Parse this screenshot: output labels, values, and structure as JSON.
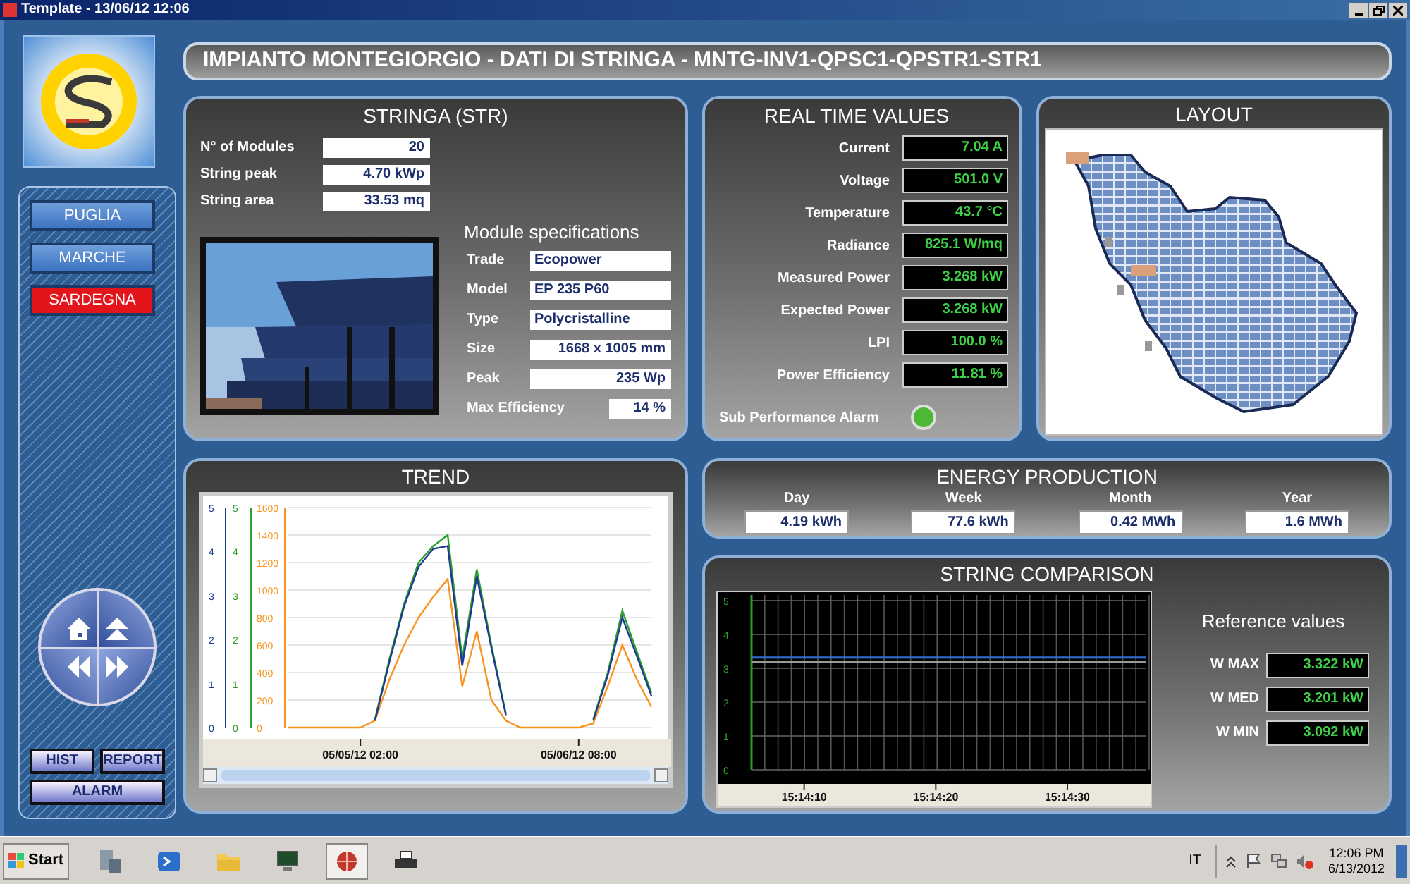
{
  "window": {
    "title": "Template - 13/06/12 12:06"
  },
  "nav": {
    "regions": [
      {
        "label": "PUGLIA",
        "selected": false
      },
      {
        "label": "MARCHE",
        "selected": false
      },
      {
        "label": "SARDEGNA",
        "selected": true
      }
    ],
    "buttons": [
      "HIST",
      "REPORT",
      "ALARM"
    ]
  },
  "header": {
    "title": "IMPIANTO MONTEGIORGIO - DATI DI STRINGA - MNTG-INV1-QPSC1-QPSTR1-STR1"
  },
  "stringa": {
    "title": "STRINGA (STR)",
    "fields": [
      {
        "label": "N° of Modules",
        "value": "20"
      },
      {
        "label": "String peak",
        "value": "4.70 kWp"
      },
      {
        "label": "String area",
        "value": "33.53 mq"
      }
    ],
    "specs_title": "Module specifications",
    "specs": [
      {
        "label": "Trade",
        "value": "Ecopower",
        "kind": "text"
      },
      {
        "label": "Model",
        "value": "EP 235 P60",
        "kind": "text"
      },
      {
        "label": "Type",
        "value": "Polycristalline",
        "kind": "text"
      },
      {
        "label": "Size",
        "value": "1668 x 1005 mm",
        "kind": "number"
      },
      {
        "label": "Peak",
        "value": "235 Wp",
        "kind": "number"
      },
      {
        "label": "Max Efficiency",
        "value": "14 %",
        "kind": "short"
      }
    ]
  },
  "realtime": {
    "title": "REAL TIME VALUES",
    "rows": [
      {
        "label": "Current",
        "value": "7.04 A"
      },
      {
        "label": "Voltage",
        "value": "501.0 V"
      },
      {
        "label": "Temperature",
        "value": "43.7 °C"
      },
      {
        "label": "Radiance",
        "value": "825.1 W/mq"
      },
      {
        "label": "Measured Power",
        "value": "3.268 kW"
      },
      {
        "label": "Expected Power",
        "value": "3.268 kW"
      },
      {
        "label": "LPI",
        "value": "100.0 %"
      },
      {
        "label": "Power Efficiency",
        "value": "11.81 %"
      }
    ],
    "alarm": {
      "label": "Sub Performance Alarm",
      "active": false
    }
  },
  "layout": {
    "title": "LAYOUT"
  },
  "trend": {
    "title": "TREND",
    "blue_axis_ticks": [
      "5",
      "4",
      "3",
      "2",
      "1",
      "0"
    ],
    "green_axis_ticks": [
      "5",
      "4",
      "3",
      "2",
      "1",
      "0"
    ],
    "chart_data": {
      "type": "line",
      "categories": [
        null,
        null,
        null,
        null,
        null,
        "05/05/12 02:00",
        null,
        null,
        null,
        null,
        null,
        null,
        null,
        null,
        null,
        null,
        null,
        null,
        null,
        null,
        "05/06/12 08:00",
        null,
        null,
        null,
        null,
        null
      ],
      "ylim": [
        0,
        1600
      ],
      "yticks": [
        0,
        200,
        400,
        600,
        800,
        1000,
        1200,
        1400,
        1600
      ],
      "series": [
        {
          "color": "#f7931e",
          "values": [
            0,
            0,
            0,
            0,
            0,
            0,
            50,
            350,
            600,
            800,
            950,
            1080,
            300,
            700,
            200,
            50,
            0,
            0,
            0,
            0,
            0,
            30,
            300,
            600,
            350,
            150
          ]
        },
        {
          "color": "#2ca02c",
          "values": [
            null,
            null,
            null,
            null,
            null,
            null,
            60,
            500,
            900,
            1200,
            1320,
            1400,
            500,
            1150,
            600,
            100,
            null,
            null,
            null,
            null,
            null,
            60,
            400,
            850,
            550,
            250
          ]
        },
        {
          "color": "#1f3a93",
          "values": [
            null,
            null,
            null,
            null,
            null,
            null,
            50,
            480,
            880,
            1170,
            1300,
            1320,
            450,
            1100,
            580,
            90,
            null,
            null,
            null,
            null,
            null,
            50,
            380,
            800,
            520,
            230
          ]
        }
      ],
      "grid": true
    }
  },
  "energy": {
    "title": "ENERGY PRODUCTION",
    "items": [
      {
        "label": "Day",
        "value": "4.19 kWh"
      },
      {
        "label": "Week",
        "value": "77.6 kWh"
      },
      {
        "label": "Month",
        "value": "0.42 MWh"
      },
      {
        "label": "Year",
        "value": "1.6 MWh"
      }
    ]
  },
  "comparison": {
    "title": "STRING COMPARISON",
    "chart_data": {
      "type": "line",
      "categories": [
        null,
        null,
        null,
        null,
        "15:14:10",
        null,
        null,
        null,
        null,
        null,
        null,
        null,
        null,
        null,
        "15:14:20",
        null,
        null,
        null,
        null,
        null,
        null,
        null,
        null,
        null,
        "15:14:30",
        null,
        null,
        null,
        null,
        null,
        null
      ],
      "ylim": [
        0,
        5
      ],
      "yticks": [
        0,
        1,
        2,
        3,
        4,
        5
      ],
      "grid": true,
      "series": [
        {
          "color": "#2f6fd6",
          "values": [
            3.32,
            3.32,
            3.32,
            3.32,
            3.32,
            3.32,
            3.32,
            3.32,
            3.32,
            3.32,
            3.32,
            3.32,
            3.32,
            3.32,
            3.32,
            3.32,
            3.32,
            3.32,
            3.32,
            3.32,
            3.32,
            3.32,
            3.32,
            3.32,
            3.32,
            3.32,
            3.32,
            3.32,
            3.32,
            3.32,
            3.32
          ]
        },
        {
          "color": "#9a9a9a",
          "values": [
            3.2,
            3.2,
            3.2,
            3.2,
            3.2,
            3.2,
            3.2,
            3.2,
            3.2,
            3.2,
            3.2,
            3.2,
            3.2,
            3.2,
            3.2,
            3.2,
            3.2,
            3.2,
            3.2,
            3.2,
            3.2,
            3.2,
            3.2,
            3.2,
            3.2,
            3.2,
            3.2,
            3.2,
            3.2,
            3.2,
            3.2
          ]
        }
      ]
    },
    "reference_title": "Reference values",
    "references": [
      {
        "label": "W MAX",
        "value": "3.322 kW"
      },
      {
        "label": "W MED",
        "value": "3.201 kW"
      },
      {
        "label": "W MIN",
        "value": "3.092 kW"
      }
    ]
  },
  "taskbar": {
    "start": "Start",
    "apps": [
      {
        "kind": "server",
        "selected": false
      },
      {
        "kind": "shell",
        "selected": false
      },
      {
        "kind": "folder",
        "selected": false
      },
      {
        "kind": "monitor",
        "selected": false
      },
      {
        "kind": "hmi",
        "selected": true
      },
      {
        "kind": "printer",
        "selected": false
      }
    ],
    "language": "IT",
    "time": "12:06 PM",
    "date": "6/13/2012"
  }
}
